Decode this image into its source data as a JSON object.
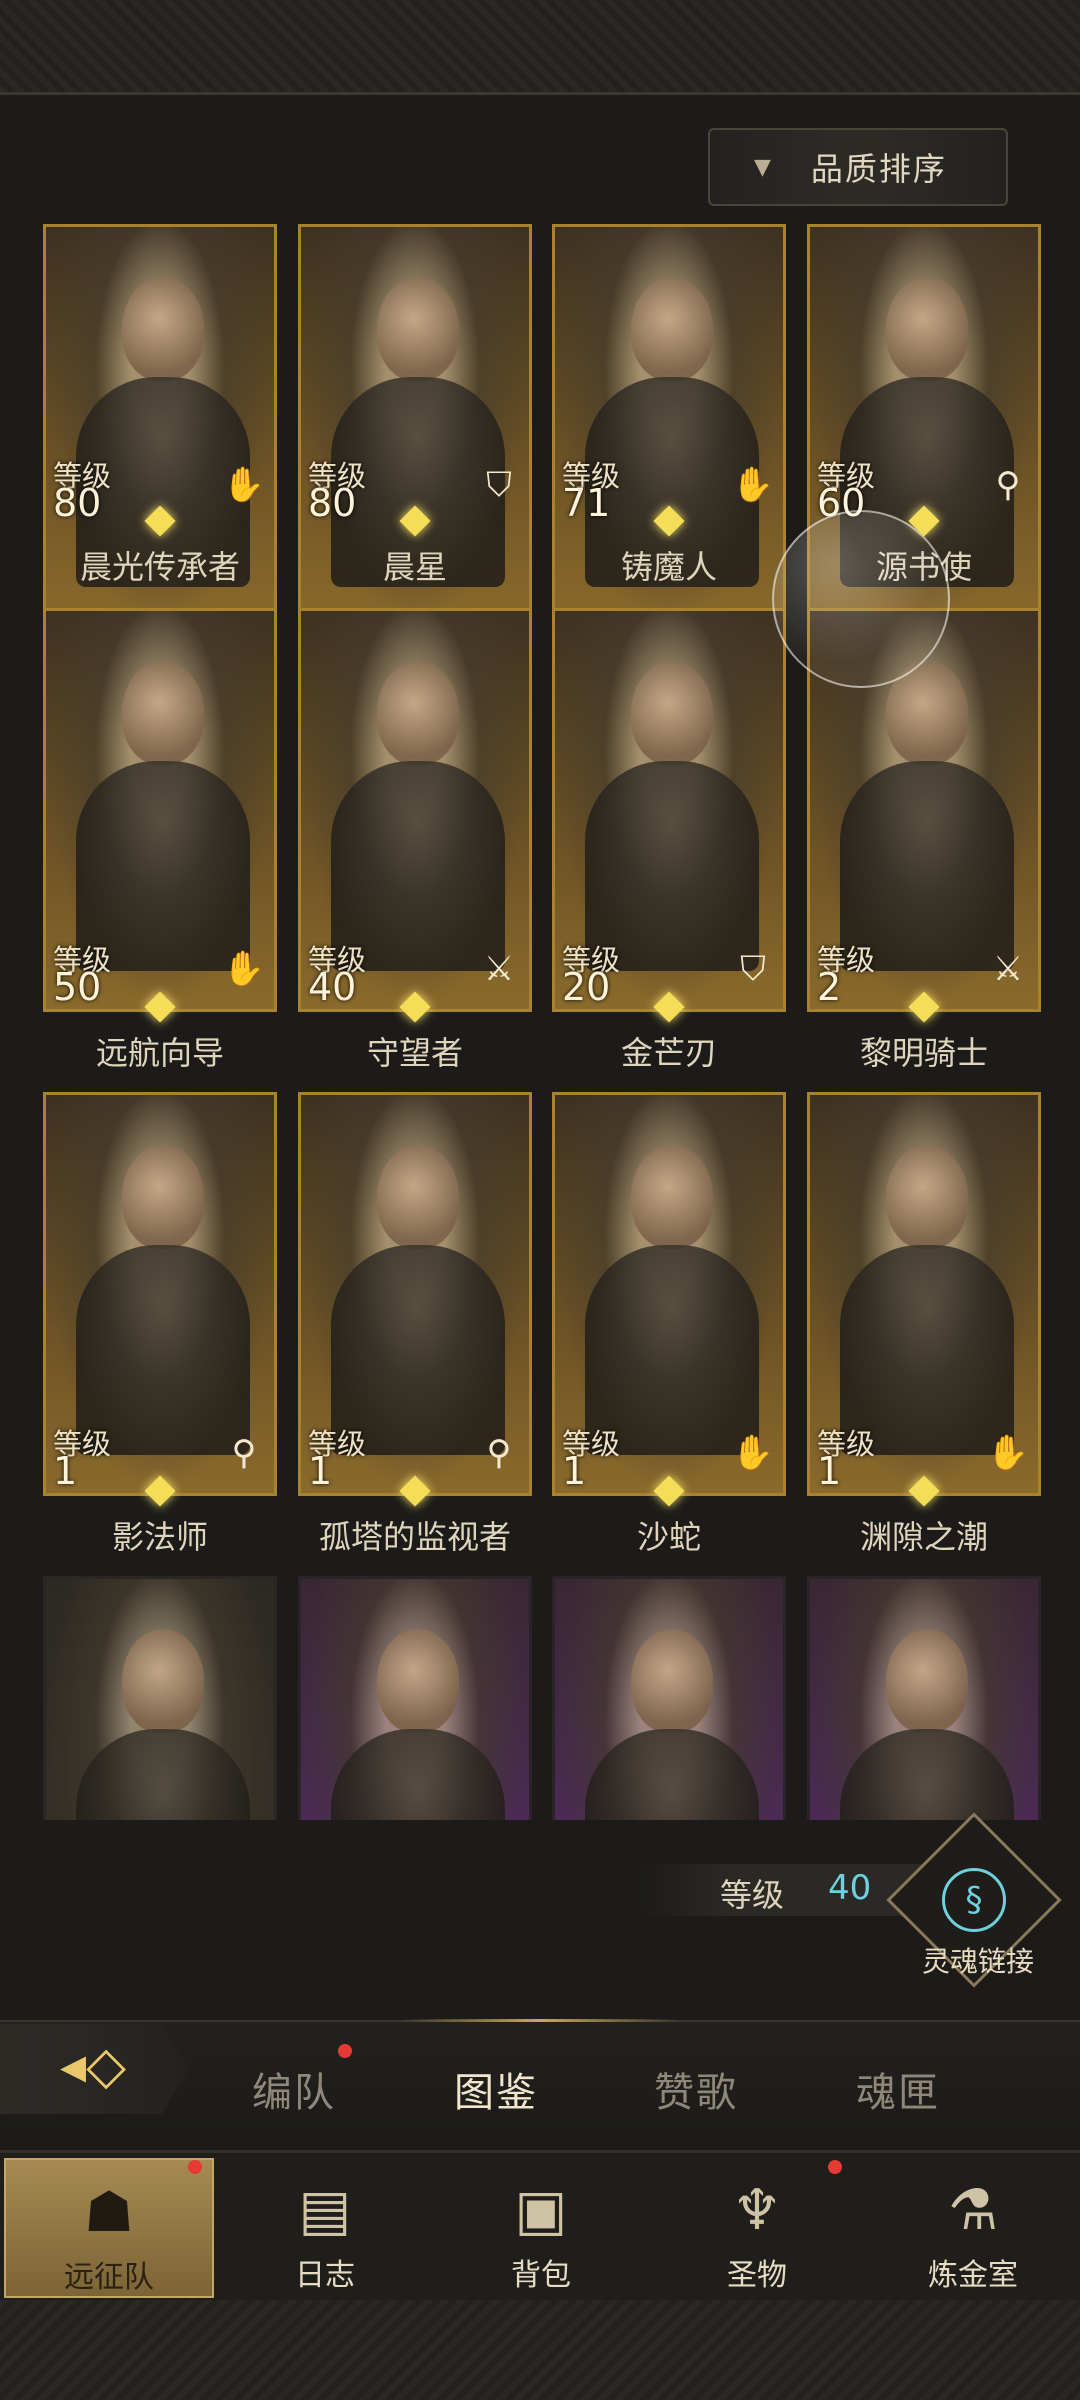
{
  "sort_button": {
    "label": "品质排序"
  },
  "level_label": "等级",
  "heroes": [
    {
      "name": "晨光传承者",
      "level": "80",
      "class_icon": "hand-icon"
    },
    {
      "name": "晨星",
      "level": "80",
      "class_icon": "shield-icon"
    },
    {
      "name": "铸魔人",
      "level": "71",
      "class_icon": "hand-icon"
    },
    {
      "name": "源书使",
      "level": "60",
      "class_icon": "staff-icon"
    },
    {
      "name": "远航向导",
      "level": "50",
      "class_icon": "hand-icon"
    },
    {
      "name": "守望者",
      "level": "40",
      "class_icon": "sword-icon"
    },
    {
      "name": "金芒刃",
      "level": "20",
      "class_icon": "shield-icon"
    },
    {
      "name": "黎明骑士",
      "level": "2",
      "class_icon": "sword-icon"
    },
    {
      "name": "影法师",
      "level": "1",
      "class_icon": "staff-icon"
    },
    {
      "name": "孤塔的监视者",
      "level": "1",
      "class_icon": "staff-icon"
    },
    {
      "name": "沙蛇",
      "level": "1",
      "class_icon": "hand-icon"
    },
    {
      "name": "渊隙之潮",
      "level": "1",
      "class_icon": "hand-icon"
    }
  ],
  "soul_link": {
    "level_label": "等级",
    "level_value": "40",
    "label": "灵魂链接"
  },
  "tabs": [
    "编队",
    "图鉴",
    "赞歌",
    "魂匣"
  ],
  "active_tab": "图鉴",
  "nav": [
    "远征队",
    "日志",
    "背包",
    "圣物",
    "炼金室"
  ],
  "active_nav": "远征队",
  "colors": {
    "gold_border": "#a8822e",
    "accent_cyan": "#6fd0e0",
    "notification_red": "#e53a34"
  }
}
